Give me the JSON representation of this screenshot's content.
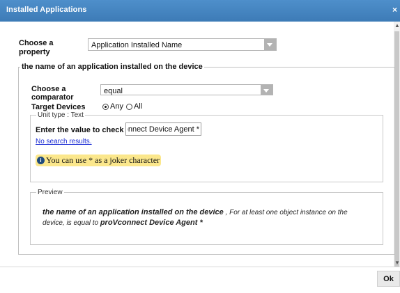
{
  "window": {
    "title": "Installed Applications",
    "close": "×"
  },
  "property": {
    "label": "Choose a property",
    "selected": "Application Installed Name"
  },
  "criterion": {
    "legend": "the name of an application installed on the device",
    "comparator_label": "Choose a comparator",
    "comparator_selected": "equal",
    "target_label": "Target Devices",
    "target_options": [
      "Any",
      "All"
    ],
    "target_selected": "Any",
    "unit_legend": "Unit type : Text",
    "enter_label": "Enter the value to check",
    "value": "proVconnect Device Agent *",
    "no_results": "No search results.",
    "hint": "You can use * as a joker character"
  },
  "preview": {
    "legend": "Preview",
    "subject": "the name of an application installed on the device",
    "middle": " , For at least one object instance on the device, is equal to ",
    "value": "proVconnect Device Agent *"
  },
  "footer": {
    "ok_label": "Ok"
  },
  "icons": {
    "info": "info-icon",
    "scroll_up": "scroll-up-icon",
    "scroll_down": "scroll-down-icon"
  }
}
